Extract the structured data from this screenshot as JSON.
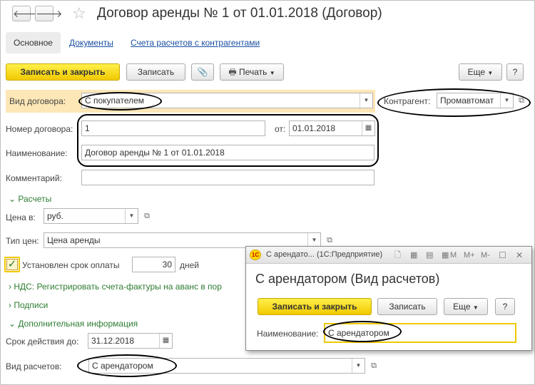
{
  "toolbar": {
    "back_glyph": "🡐",
    "forward_glyph": "🡒",
    "star_glyph": "☆",
    "title": "Договор аренды № 1 от 01.01.2018 (Договор)"
  },
  "tabs": {
    "main": "Основное",
    "documents": "Документы",
    "accounts": "Счета расчетов с контрагентами"
  },
  "actions": {
    "save_close": "Записать и закрыть",
    "save": "Записать",
    "clip_glyph": "📎",
    "print": "Печать",
    "print_icon": "🖶",
    "more": "Еще",
    "help": "?"
  },
  "form": {
    "contract_type_label": "Вид договора:",
    "contract_type_value": "С покупателем",
    "counterparty_label": "Контрагент:",
    "counterparty_value": "Промавтомат",
    "number_label": "Номер договора:",
    "number_value": "1",
    "date_label": "от:",
    "date_value": "01.01.2018",
    "name_label": "Наименование:",
    "name_value": "Договор аренды № 1 от 01.01.2018",
    "comment_label": "Комментарий:",
    "comment_value": "",
    "settlements_section": "Расчеты",
    "price_in_label": "Цена в:",
    "price_in_value": "руб.",
    "price_type_label": "Тип цен:",
    "price_type_value": "Цена аренды",
    "payment_term_label": "Установлен срок оплаты",
    "payment_term_checked": true,
    "payment_days_value": "30",
    "days_label": "дней",
    "vat_section": "НДС: Регистрировать счета-фактуры на аванс в пор",
    "signatures_section": "Подписи",
    "extra_section": "Дополнительная информация",
    "valid_until_label": "Срок действия до:",
    "valid_until_value": "31.12.2018",
    "settlement_kind_label": "Вид расчетов:",
    "settlement_kind_value": "С арендатором"
  },
  "popup": {
    "window_title": "С арендато...  (1С:Предприятие)",
    "logo_text": "1С",
    "memory_buttons": [
      "M",
      "M+",
      "M-"
    ],
    "heading": "С арендатором (Вид расчетов)",
    "save_close": "Записать и закрыть",
    "save": "Записать",
    "more": "Еще",
    "help": "?",
    "name_label": "Наименование:",
    "name_value": "С арендатором"
  },
  "colors": {
    "accent_yellow": "#f1c900",
    "highlight_row": "#fde7b6",
    "link_blue": "#1a4fa3",
    "section_green": "#2e7d32"
  }
}
